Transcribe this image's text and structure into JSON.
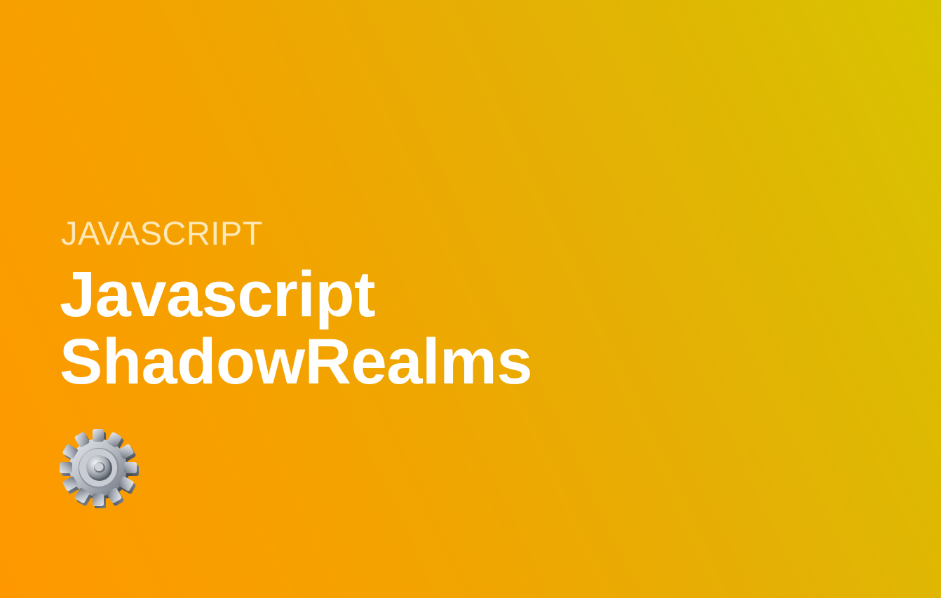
{
  "category": "JAVASCRIPT",
  "title": {
    "line1": "Javascript",
    "line2": "ShadowRealms"
  },
  "icon": "gear-icon",
  "colors": {
    "gradient_start": "#ff9800",
    "gradient_end": "#d8c300",
    "title_text": "#ffffff",
    "category_text": "#fff8e1"
  }
}
